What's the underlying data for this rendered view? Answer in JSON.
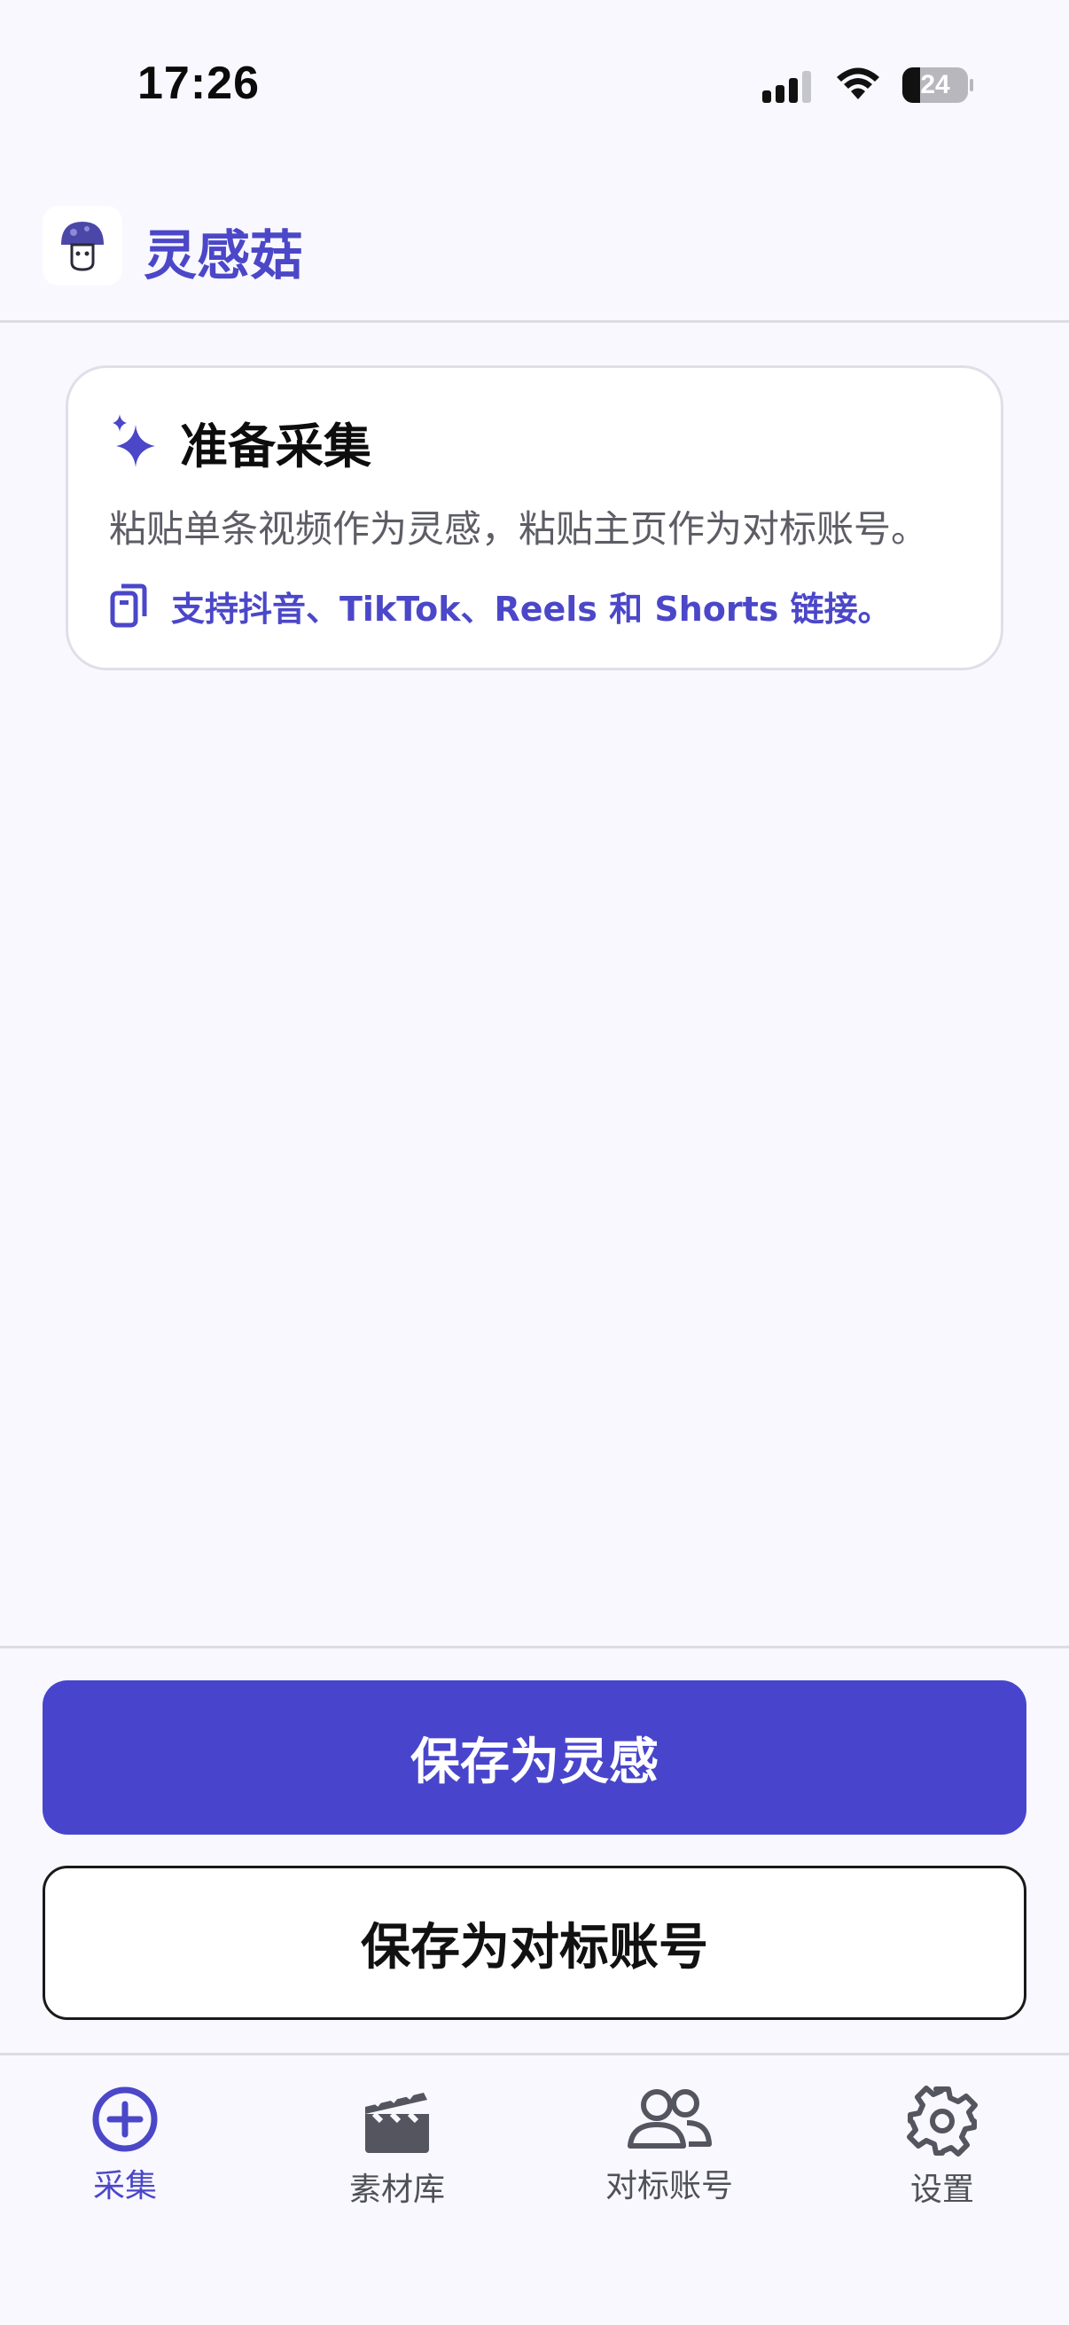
{
  "status_bar": {
    "time": "17:26",
    "battery": "24"
  },
  "header": {
    "app_name": "灵感菇",
    "logo_icon": "mushroom-logo-icon"
  },
  "card": {
    "title": "准备采集",
    "description": "粘贴单条视频作为灵感，粘贴主页作为对标账号。",
    "note": "支持抖音、TikTok、Reels 和 Shorts 链接。"
  },
  "actions": {
    "save_inspiration": "保存为灵感",
    "save_benchmark": "保存为对标账号"
  },
  "tabs": [
    {
      "label": "采集",
      "icon": "plus-circle-icon",
      "active": true
    },
    {
      "label": "素材库",
      "icon": "clapperboard-icon",
      "active": false
    },
    {
      "label": "对标账号",
      "icon": "users-icon",
      "active": false
    },
    {
      "label": "设置",
      "icon": "gear-icon",
      "active": false
    }
  ],
  "colors": {
    "accent": "#4845cc",
    "background": "#f8f8fe"
  }
}
